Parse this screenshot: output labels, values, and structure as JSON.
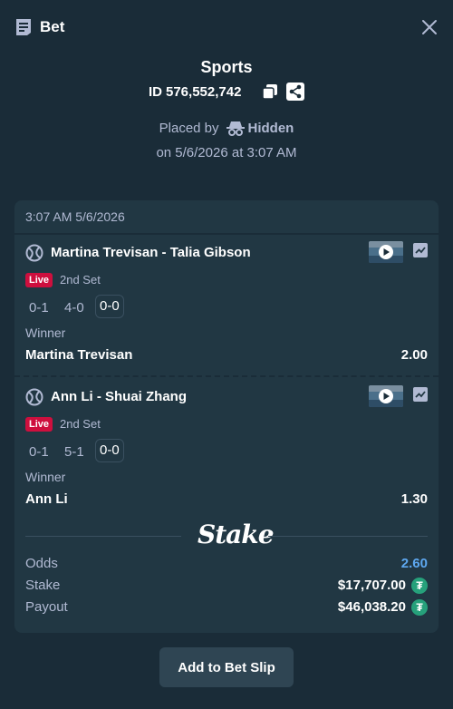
{
  "header": {
    "title": "Bet"
  },
  "bet": {
    "category": "Sports",
    "id_label": "ID",
    "id_value": "576,552,742",
    "placed_by_label": "Placed by",
    "placed_by_user": "Hidden",
    "placed_on": "on 5/6/2026 at 3:07 AM"
  },
  "card": {
    "timestamp": "3:07 AM 5/6/2026",
    "legs": [
      {
        "event": "Martina Trevisan - Talia Gibson",
        "live": "Live",
        "set": "2nd Set",
        "scores": [
          "0-1",
          "4-0",
          "0-0"
        ],
        "market": "Winner",
        "selection": "Martina Trevisan",
        "odds": "2.00"
      },
      {
        "event": "Ann Li - Shuai Zhang",
        "live": "Live",
        "set": "2nd Set",
        "scores": [
          "0-1",
          "5-1",
          "0-0"
        ],
        "market": "Winner",
        "selection": "Ann Li",
        "odds": "1.30"
      }
    ],
    "logo": "Stake",
    "summary": {
      "odds_label": "Odds",
      "odds_value": "2.60",
      "stake_label": "Stake",
      "stake_value": "$17,707.00",
      "payout_label": "Payout",
      "payout_value": "$46,038.20",
      "currency_icon": "tether-coin-icon"
    }
  },
  "actions": {
    "add_to_slip": "Add to Bet Slip"
  },
  "colors": {
    "background": "#1a2c38",
    "card": "#213743",
    "live_badge": "#ce0f3e",
    "odds_accent": "#5ea8f0",
    "tether": "#26a17b"
  }
}
